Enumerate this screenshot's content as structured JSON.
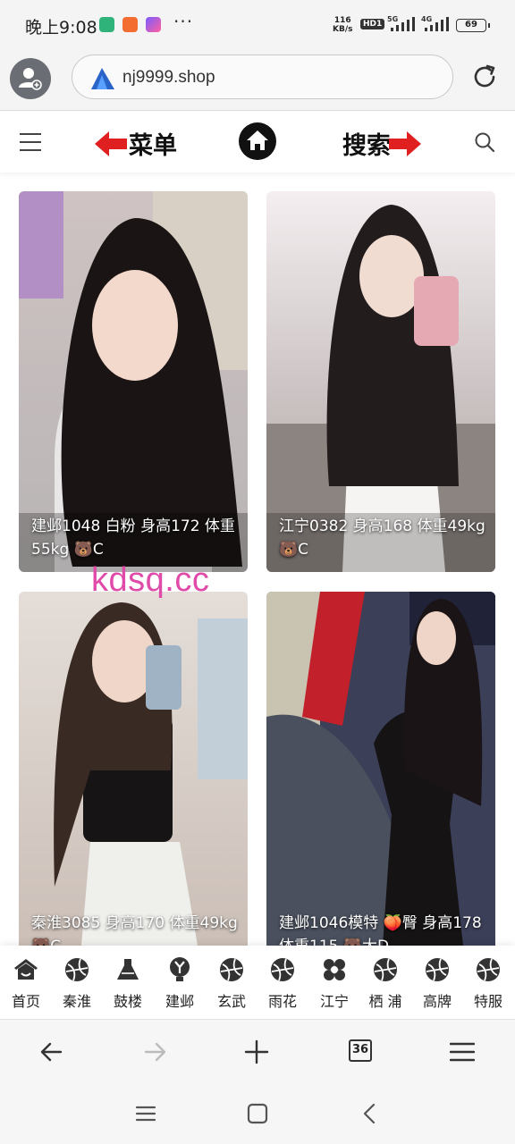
{
  "status_bar": {
    "time": "晚上9:08",
    "more": "···",
    "net_speed_value": "116",
    "net_speed_unit": "KB/s",
    "hd_badge": "HD1",
    "signal_1": "5G",
    "signal_2": "4G",
    "battery": "69"
  },
  "address_bar": {
    "url": "nj9999.shop",
    "avatar_icon": "user-add-icon",
    "reload_icon": "reload-icon"
  },
  "site_header": {
    "menu_label": "菜单",
    "search_label": "搜索",
    "arrow_color": "#e02020"
  },
  "cards": [
    {
      "caption": "建邺1048 白粉 身高172 体重55kg 🐻C"
    },
    {
      "caption": "江宁0382 身高168 体重49kg 🐻C"
    },
    {
      "caption": "秦淮3085 身高170 体重49kg 🐻C"
    },
    {
      "caption": "建邺1046模特 🍑臀 身高178 体重115 🐻大D"
    }
  ],
  "watermark": "kdsq.cc",
  "category_nav": [
    {
      "label": "首页",
      "icon": "home-icon"
    },
    {
      "label": "秦淮",
      "icon": "ball-icon"
    },
    {
      "label": "鼓楼",
      "icon": "flask-icon"
    },
    {
      "label": "建邺",
      "icon": "y-badge-icon"
    },
    {
      "label": "玄武",
      "icon": "ball-icon"
    },
    {
      "label": "雨花",
      "icon": "ball-icon"
    },
    {
      "label": "江宁",
      "icon": "flower-icon"
    },
    {
      "label": "栖 浦",
      "icon": "ball-icon"
    },
    {
      "label": "高牌",
      "icon": "ball-icon"
    },
    {
      "label": "特服",
      "icon": "ball-icon"
    }
  ],
  "browser_toolbar": {
    "tab_count": "36"
  }
}
